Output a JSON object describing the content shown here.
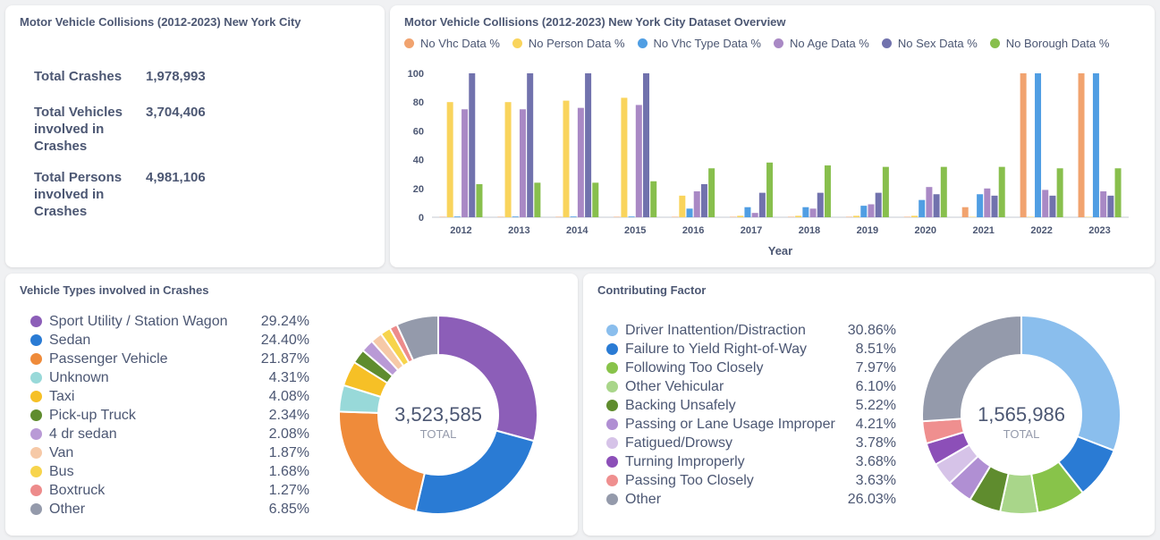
{
  "totals": {
    "title": "Motor Vehicle Collisions (2012-2023) New York City",
    "items": [
      {
        "label": "Total Crashes",
        "value": "1,978,993"
      },
      {
        "label": "Total Vehicles involved in Crashes",
        "value": "3,704,406"
      },
      {
        "label": "Total Persons involved in Crashes",
        "value": "4,981,106"
      }
    ]
  },
  "overview": {
    "title": "Motor Vehicle Collisions (2012-2023) New York City Dataset Overview",
    "chart_data": {
      "type": "bar",
      "title": "Motor Vehicle Collisions (2012-2023) New York City Dataset Overview",
      "xlabel": "Year",
      "ylabel": "",
      "ylim": [
        0,
        100
      ],
      "yticks": [
        0,
        20,
        40,
        60,
        80,
        100
      ],
      "grid": false,
      "legend_position": "top",
      "categories": [
        "2012",
        "2013",
        "2014",
        "2015",
        "2016",
        "2017",
        "2018",
        "2019",
        "2020",
        "2021",
        "2022",
        "2023"
      ],
      "series": [
        {
          "name": "No Vhc Data %",
          "color": "#f1a36f",
          "values": [
            0.3,
            0.3,
            0.3,
            0.3,
            0.3,
            0.3,
            0.3,
            0.3,
            0.3,
            7,
            100,
            100
          ]
        },
        {
          "name": "No Person Data %",
          "color": "#f9d45c",
          "values": [
            80,
            80,
            81,
            83,
            15,
            1,
            1,
            1,
            1,
            0.3,
            0.3,
            0.3
          ]
        },
        {
          "name": "No Vhc Type Data %",
          "color": "#509ee3",
          "values": [
            0.5,
            0.5,
            0.5,
            0.5,
            6,
            7,
            7,
            8,
            12,
            16,
            100,
            100
          ]
        },
        {
          "name": "No Age Data %",
          "color": "#a989c5",
          "values": [
            75,
            75,
            76,
            78,
            18,
            3,
            6,
            9,
            21,
            20,
            19,
            18
          ]
        },
        {
          "name": "No Sex Data %",
          "color": "#7172ad",
          "values": [
            100,
            100,
            100,
            100,
            23,
            17,
            17,
            17,
            16,
            15,
            15,
            15
          ]
        },
        {
          "name": "No Borough Data %",
          "color": "#88bf4d",
          "values": [
            23,
            24,
            24,
            25,
            34,
            38,
            36,
            35,
            35,
            35,
            34,
            34
          ]
        }
      ]
    }
  },
  "vehicles": {
    "title": "Vehicle Types involved in Crashes",
    "chart_data": {
      "type": "pie",
      "title": "Vehicle Types involved in Crashes",
      "total_value": "3,523,585",
      "total_label": "TOTAL",
      "slices": [
        {
          "label": "Sport Utility / Station Wagon",
          "pct_label": "29.24%",
          "value": 29.24,
          "color": "#8c5eb8"
        },
        {
          "label": "Sedan",
          "pct_label": "24.40%",
          "value": 24.4,
          "color": "#2a7bd4"
        },
        {
          "label": "Passenger Vehicle",
          "pct_label": "21.87%",
          "value": 21.87,
          "color": "#ef8b3a"
        },
        {
          "label": "Unknown",
          "pct_label": "4.31%",
          "value": 4.31,
          "color": "#98d9d9"
        },
        {
          "label": "Taxi",
          "pct_label": "4.08%",
          "value": 4.08,
          "color": "#f6c026"
        },
        {
          "label": "Pick-up Truck",
          "pct_label": "2.34%",
          "value": 2.34,
          "color": "#5f8c2e"
        },
        {
          "label": "4 dr sedan",
          "pct_label": "2.08%",
          "value": 2.08,
          "color": "#b99ad6"
        },
        {
          "label": "Van",
          "pct_label": "1.87%",
          "value": 1.87,
          "color": "#f6c9a7"
        },
        {
          "label": "Bus",
          "pct_label": "1.68%",
          "value": 1.68,
          "color": "#f7d44c"
        },
        {
          "label": "Boxtruck",
          "pct_label": "1.27%",
          "value": 1.27,
          "color": "#ed8b8b"
        },
        {
          "label": "Other",
          "pct_label": "6.85%",
          "value": 6.85,
          "color": "#949aab"
        }
      ]
    }
  },
  "factors": {
    "title": "Contributing Factor",
    "chart_data": {
      "type": "pie",
      "title": "Contributing Factor",
      "total_value": "1,565,986",
      "total_label": "TOTAL",
      "slices": [
        {
          "label": "Driver Inattention/Distraction",
          "pct_label": "30.86%",
          "value": 30.86,
          "color": "#8abeed"
        },
        {
          "label": "Failure to Yield Right-of-Way",
          "pct_label": "8.51%",
          "value": 8.51,
          "color": "#2a7bd4"
        },
        {
          "label": "Following Too Closely",
          "pct_label": "7.97%",
          "value": 7.97,
          "color": "#88c34a"
        },
        {
          "label": "Other Vehicular",
          "pct_label": "6.10%",
          "value": 6.1,
          "color": "#a9d68a"
        },
        {
          "label": "Backing Unsafely",
          "pct_label": "5.22%",
          "value": 5.22,
          "color": "#5f8c2e"
        },
        {
          "label": "Passing or Lane Usage Improper",
          "pct_label": "4.21%",
          "value": 4.21,
          "color": "#b08fd3"
        },
        {
          "label": "Fatigued/Drowsy",
          "pct_label": "3.78%",
          "value": 3.78,
          "color": "#d6c3e8"
        },
        {
          "label": "Turning Improperly",
          "pct_label": "3.68%",
          "value": 3.68,
          "color": "#8c4fb8"
        },
        {
          "label": "Passing Too Closely",
          "pct_label": "3.63%",
          "value": 3.63,
          "color": "#ef8f8f"
        },
        {
          "label": "Other",
          "pct_label": "26.03%",
          "value": 26.03,
          "color": "#949aab"
        }
      ]
    }
  }
}
